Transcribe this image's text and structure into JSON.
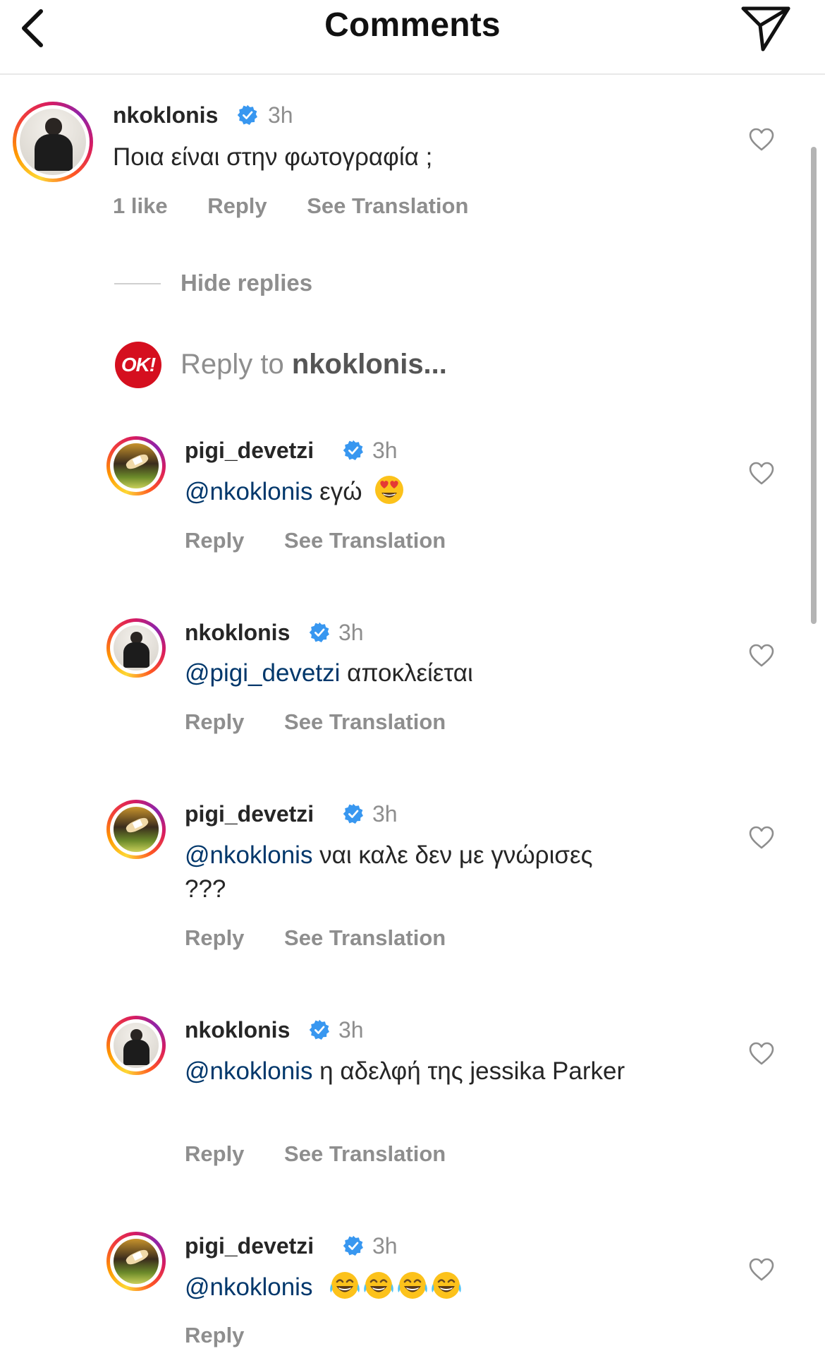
{
  "header": {
    "title": "Comments"
  },
  "top_comment": {
    "username": "nkoklonis",
    "time": "3h",
    "text": "Ποια είναι στην φωτογραφία ;",
    "likes": "1 like",
    "reply": "Reply",
    "translate": "See Translation"
  },
  "hide_replies": "Hide replies",
  "reply_input": {
    "logo": "OK!",
    "prefix": "Reply to ",
    "target": "nkoklonis..."
  },
  "replies": [
    {
      "username": "pigi_devetzi",
      "time": "3h",
      "mention": "@nkoklonis",
      "text": " εγώ",
      "reply": "Reply",
      "translate": "See Translation"
    },
    {
      "username": "nkoklonis",
      "time": "3h",
      "mention": "@pigi_devetzi",
      "text": " αποκλείεται",
      "reply": "Reply",
      "translate": "See Translation"
    },
    {
      "username": "pigi_devetzi",
      "time": "3h",
      "mention": "@nkoklonis",
      "text": " ναι καλε δεν με γνώρισες ???",
      "reply": "Reply",
      "translate": "See Translation"
    },
    {
      "username": "nkoklonis",
      "time": "3h",
      "mention": "@nkoklonis",
      "text": " η αδελφή της jessika Parker",
      "reply": "Reply",
      "translate": "See Translation"
    },
    {
      "username": "pigi_devetzi",
      "time": "3h",
      "mention": "@nkoklonis",
      "text": " ",
      "reply": "Reply"
    }
  ],
  "icons": {
    "back": "chevron-left-icon",
    "send": "paper-plane-icon",
    "verified": "verified-badge-icon",
    "like": "heart-outline-icon",
    "emoji_heart_eyes": "heart-eyes-emoji",
    "emoji_laugh": "tears-of-joy-emoji"
  },
  "colors": {
    "verified": "#3897f0",
    "mention": "#00376b",
    "muted": "#8e8e8e",
    "ok_brand": "#d50f1f"
  }
}
